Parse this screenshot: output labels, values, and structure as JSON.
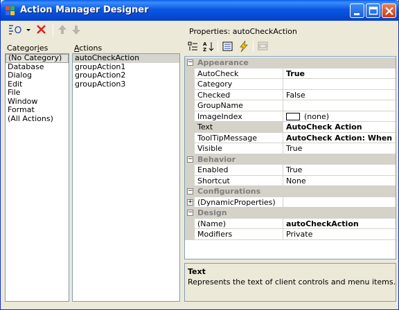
{
  "window": {
    "title": "Action Manager Designer"
  },
  "toolbar": {
    "items": [
      "new-action-dropdown",
      "delete",
      "move-up",
      "move-down"
    ]
  },
  "properties_header": "Properties: autoCheckAction",
  "categories": {
    "label_prefix": "Categor",
    "label_underline": "i",
    "label_suffix": "es",
    "items": [
      "(No Category)",
      "Database",
      "Dialog",
      "Edit",
      "File",
      "Window",
      "Format",
      "(All Actions)"
    ],
    "selected_index": 0
  },
  "actions": {
    "label_underline": "A",
    "label_suffix": "ctions",
    "items": [
      "autoCheckAction",
      "groupAction1",
      "groupAction2",
      "groupAction3"
    ],
    "selected_index": 0
  },
  "grid": {
    "rows": [
      {
        "kind": "category",
        "name": "Appearance"
      },
      {
        "kind": "prop",
        "name": "AutoCheck",
        "value": "True",
        "bold": true
      },
      {
        "kind": "prop",
        "name": "Category",
        "value": ""
      },
      {
        "kind": "prop",
        "name": "Checked",
        "value": "False"
      },
      {
        "kind": "prop",
        "name": "GroupName",
        "value": ""
      },
      {
        "kind": "prop",
        "name": "ImageIndex",
        "value": "(none)",
        "swatch": true
      },
      {
        "kind": "prop",
        "name": "Text",
        "value": "AutoCheck Action",
        "bold": true,
        "selected": true
      },
      {
        "kind": "prop",
        "name": "ToolTipMessage",
        "value": "AutoCheck Action: When it is",
        "bold": true
      },
      {
        "kind": "prop",
        "name": "Visible",
        "value": "True"
      },
      {
        "kind": "category",
        "name": "Behavior"
      },
      {
        "kind": "prop",
        "name": "Enabled",
        "value": "True"
      },
      {
        "kind": "prop",
        "name": "Shortcut",
        "value": "None"
      },
      {
        "kind": "category",
        "name": "Configurations"
      },
      {
        "kind": "prop",
        "name": "(DynamicProperties)",
        "value": "",
        "expandable": true
      },
      {
        "kind": "category",
        "name": "Design"
      },
      {
        "kind": "prop",
        "name": "(Name)",
        "value": "autoCheckAction",
        "bold": true
      },
      {
        "kind": "prop",
        "name": "Modifiers",
        "value": "Private"
      }
    ]
  },
  "description": {
    "title": "Text",
    "text": "Represents the text of client controls and menu items."
  },
  "colors": {
    "titlebar": "#0a58e0",
    "face": "#ece9d8",
    "border": "#7f9db9",
    "category_text": "#808080"
  }
}
